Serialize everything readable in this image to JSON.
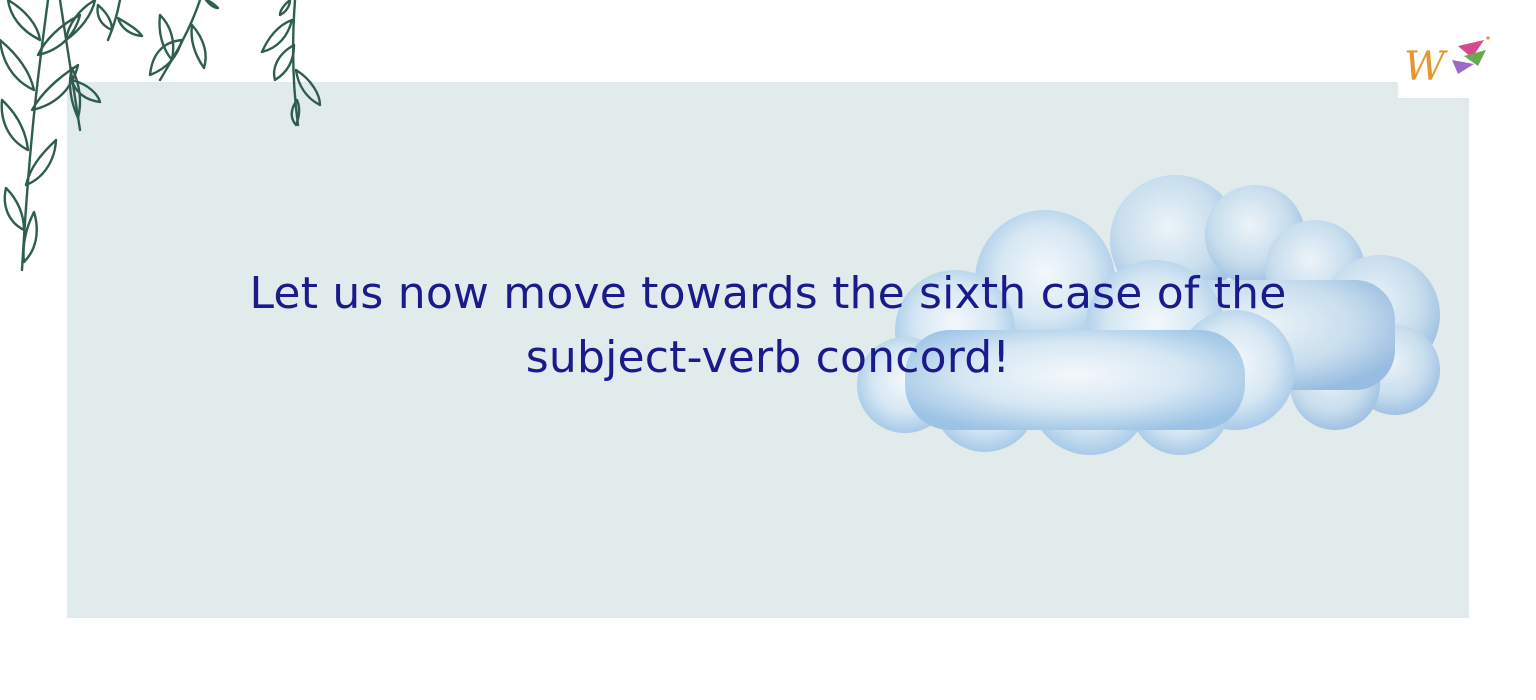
{
  "slide": {
    "headline_line1": "Let us now move towards the sixth case of the",
    "headline_line2": "subject-verb concord!",
    "text_color": "#1a1a8c",
    "panel_color": "#e1ebeb",
    "background_color": "#ffffff"
  },
  "decorations": {
    "top_left": "hanging-vines-icon",
    "right": "watercolor-cloud-icon",
    "logo": "brand-logo-icon",
    "leaf_color": "#2f5d50",
    "cloud_color": "#a9cde8"
  },
  "logo": {
    "letter": "W",
    "colors": [
      "#e8952e",
      "#d64a8c",
      "#6aa84f",
      "#9b6bc6"
    ]
  }
}
